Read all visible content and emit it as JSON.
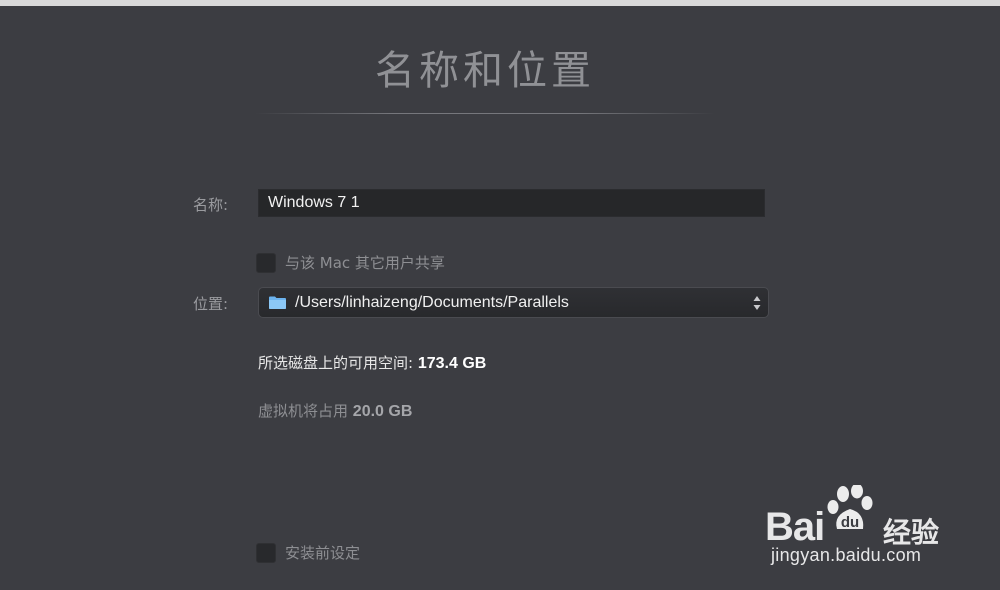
{
  "header": {
    "title": "名称和位置"
  },
  "name_field": {
    "label": "名称:",
    "value": "Windows 7 1"
  },
  "share_option": {
    "label": "与该 Mac 其它用户共享",
    "checked": false
  },
  "location_field": {
    "label": "位置:",
    "value": "/Users/linhaizeng/Documents/Parallels",
    "icon": "folder-icon"
  },
  "disk_info": {
    "free_space_label": "所选磁盘上的可用空间:",
    "free_space_value": "173.4 GB",
    "vm_usage_label": "虚拟机将占用",
    "vm_usage_value": "20.0 GB"
  },
  "setup_option": {
    "label": "安装前设定",
    "checked": false
  },
  "watermark": {
    "brand_prefix": "Bai",
    "brand_suffix": "经验",
    "url": "jingyan.baidu.com"
  },
  "colors": {
    "background": "#3c3d42",
    "input_background": "#262729",
    "folder_blue": "#6cb4f0"
  }
}
